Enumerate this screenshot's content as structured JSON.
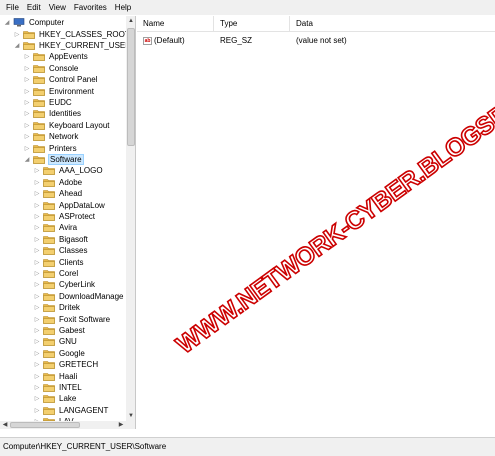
{
  "menu": [
    "File",
    "Edit",
    "View",
    "Favorites",
    "Help"
  ],
  "tree": {
    "root": "Computer",
    "hives": [
      "HKEY_CLASSES_ROOT",
      "HKEY_CURRENT_USER"
    ],
    "hkcu_children": [
      "AppEvents",
      "Console",
      "Control Panel",
      "Environment",
      "EUDC",
      "Identities",
      "Keyboard Layout",
      "Network",
      "Printers",
      "Software"
    ],
    "selected": "Software",
    "software_children": [
      "AAA_LOGO",
      "Adobe",
      "Ahead",
      "AppDataLow",
      "ASProtect",
      "Avira",
      "Bigasoft",
      "Classes",
      "Clients",
      "Corel",
      "CyberLink",
      "DownloadManage",
      "Dritek",
      "Foxit Software",
      "Gabest",
      "GNU",
      "Google",
      "GRETECH",
      "Haali",
      "INTEL",
      "Lake",
      "LANGAGENT",
      "LAV"
    ]
  },
  "list": {
    "columns": [
      "Name",
      "Type",
      "Data"
    ],
    "rows": [
      {
        "name": "(Default)",
        "type": "REG_SZ",
        "data": "(value not set)",
        "icon": "ab-string-icon"
      }
    ]
  },
  "icons": {
    "string_value": "ab"
  },
  "watermark": "WWW.NETWORK-CYBER.BLOGSPOT.COM",
  "status": "Computer\\HKEY_CURRENT_USER\\Software",
  "colors": {
    "folder": "#e8b94a",
    "selection": "#cce8ff",
    "watermark": "#cc0000"
  }
}
